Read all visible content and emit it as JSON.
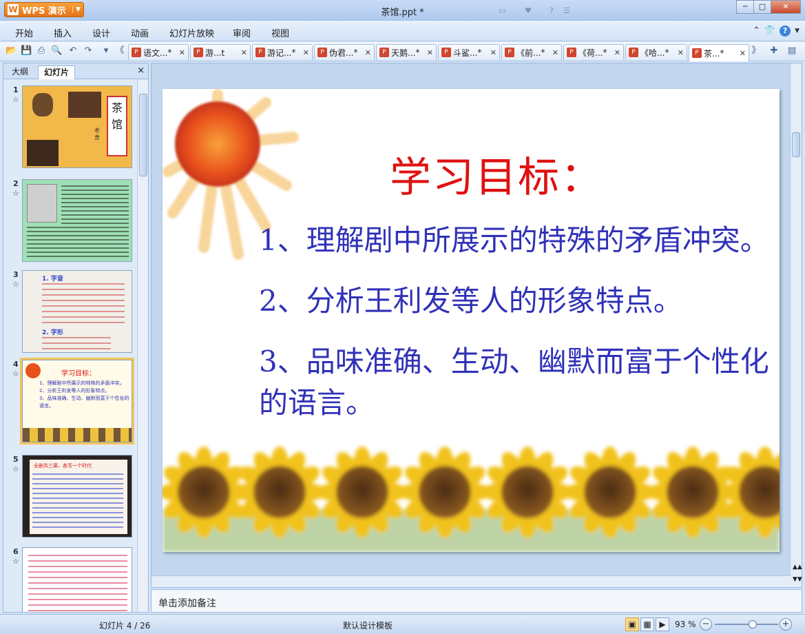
{
  "app": {
    "button_label": "WPS 演示",
    "document_title": "茶馆.ppt *"
  },
  "window": {
    "minimize": "─",
    "maximize": "□",
    "close": "✕"
  },
  "menu": {
    "items": [
      "开始",
      "插入",
      "设计",
      "动画",
      "幻灯片放映",
      "审阅",
      "视图"
    ]
  },
  "doc_tabs": [
    {
      "label": "语文...",
      "modified": true
    },
    {
      "label": "游...t",
      "modified": false
    },
    {
      "label": "游记...",
      "modified": true
    },
    {
      "label": "伪君...",
      "modified": true
    },
    {
      "label": "天鹅...",
      "modified": true
    },
    {
      "label": "斗鲨...",
      "modified": true
    },
    {
      "label": "《前...",
      "modified": true
    },
    {
      "label": "《荷...",
      "modified": true
    },
    {
      "label": "《哈...",
      "modified": true
    },
    {
      "label": "茶...",
      "modified": true,
      "active": true
    }
  ],
  "left_panel": {
    "tabs": [
      "大纲",
      "幻灯片"
    ],
    "active_tab": "幻灯片",
    "close": "×",
    "slides": [
      {
        "num": "1",
        "theme": "title",
        "title_text": "茶馆",
        "subtitle": "老舍"
      },
      {
        "num": "2",
        "theme": "author"
      },
      {
        "num": "3",
        "theme": "pinyin",
        "heading1": "1. 字音",
        "heading2": "2. 字形"
      },
      {
        "num": "4",
        "theme": "goals",
        "selected": true,
        "heading": "学习目标：",
        "lines": [
          "1、理解剧中所展示的特殊的矛盾冲突。",
          "2、分析王利发等人的形象特点。",
          "3、品味准确、生动、幽默而富于个性化的语言。"
        ]
      },
      {
        "num": "5",
        "theme": "dark",
        "heading": "全剧共三幕，各写一个时代"
      },
      {
        "num": "6",
        "theme": "text"
      }
    ]
  },
  "slide": {
    "title": "学习目标：",
    "points": [
      "1、理解剧中所展示的特殊的矛盾冲突。",
      "2、分析王利发等人的形象特点。",
      "3、品味准确、生动、幽默而富于个性化的语言。"
    ],
    "colors": {
      "title": "#e01010",
      "body": "#3031b8"
    }
  },
  "notes": {
    "placeholder": "单击添加备注"
  },
  "status": {
    "slide_counter": "幻灯片 4 / 26",
    "template": "默认设计模板",
    "zoom": "93 %",
    "zoom_value": 0.6
  }
}
